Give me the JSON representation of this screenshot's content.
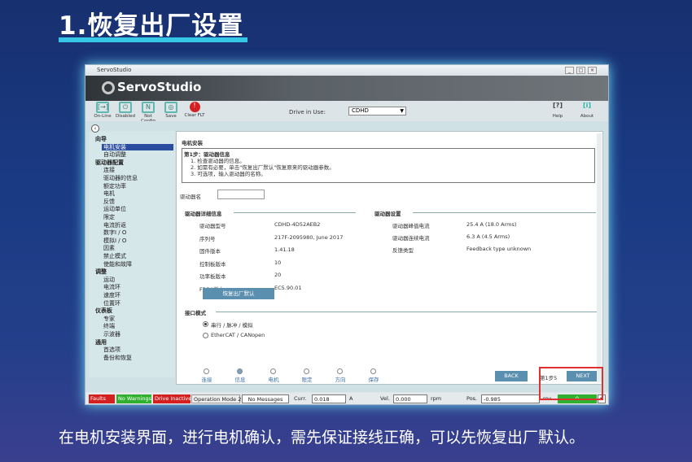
{
  "headline": "1.恢复出厂设置",
  "caption": "在电机安装界面，进行电机确认，需先保证接线正确，可以先恢复出厂默认。",
  "window": {
    "title": "ServoStudio",
    "controls": [
      "_",
      "□",
      "×"
    ]
  },
  "banner": {
    "logo": "ServoStudio"
  },
  "toolbar": {
    "buttons": [
      {
        "label": "On-Line",
        "icon": "online-icon",
        "glyph": "[→]"
      },
      {
        "label": "Disabled",
        "icon": "power-icon",
        "glyph": "⏻"
      },
      {
        "label": "Not Config",
        "icon": "config-icon",
        "glyph": "N"
      },
      {
        "label": "Save",
        "icon": "save-icon",
        "glyph": "◎"
      },
      {
        "label": "Clear FLT",
        "icon": "clear-fault-icon",
        "glyph": "!"
      }
    ],
    "drive_label": "Drive in Use:",
    "drive_value": "CDHD",
    "help": {
      "label": "Help",
      "glyph": "[?]"
    },
    "about": {
      "label": "About",
      "glyph": "[i]"
    }
  },
  "nav": [
    {
      "label": "向导",
      "level": 0,
      "group": true
    },
    {
      "label": "电机安装",
      "level": 1,
      "selected": true
    },
    {
      "label": "自动调整",
      "level": 1
    },
    {
      "label": "驱动器配置",
      "level": 0,
      "group": true
    },
    {
      "label": "连接",
      "level": 1
    },
    {
      "label": "驱动器的信息",
      "level": 1
    },
    {
      "label": "额定功率",
      "level": 1
    },
    {
      "label": "电机",
      "level": 1
    },
    {
      "label": "反馈",
      "level": 1
    },
    {
      "label": "运动单位",
      "level": 1
    },
    {
      "label": "限定",
      "level": 1
    },
    {
      "label": "电流折返",
      "level": 1
    },
    {
      "label": "数字I / O",
      "level": 1
    },
    {
      "label": "模拟I / O",
      "level": 1
    },
    {
      "label": "因素",
      "level": 1
    },
    {
      "label": "禁止模式",
      "level": 1
    },
    {
      "label": "使能和故障",
      "level": 1
    },
    {
      "label": "调整",
      "level": 0,
      "group": true
    },
    {
      "label": "运动",
      "level": 1
    },
    {
      "label": "电流环",
      "level": 1
    },
    {
      "label": "速度环",
      "level": 1
    },
    {
      "label": "位置环",
      "level": 1
    },
    {
      "label": "仪表板",
      "level": 0,
      "group": true
    },
    {
      "label": "专家",
      "level": 1
    },
    {
      "label": "终端",
      "level": 1
    },
    {
      "label": "示波器",
      "level": 1
    },
    {
      "label": "通用",
      "level": 0,
      "group": true
    },
    {
      "label": "首选项",
      "level": 1
    },
    {
      "label": "备份和恢复",
      "level": 1
    }
  ],
  "panel": {
    "title": "电机安装",
    "step_title": "第1步：驱动器信息",
    "step_lines": [
      "1. 检查驱动器的信息。",
      "2. 如需有必要，单击\"恢复出厂默认\"恢复原来的驱动器参数。",
      "3. 可选项，输入驱动器的名称。"
    ],
    "drive_name_label": "驱动器名",
    "drive_name_value": "",
    "details_title": "驱动器详细信息",
    "details": [
      {
        "label": "驱动器型号",
        "value": "CDHD-4D52AEB2"
      },
      {
        "label": "序列号",
        "value": "217F-2095980, June 2017"
      },
      {
        "label": "固件版本",
        "value": "1.41.18"
      },
      {
        "label": "控制板版本",
        "value": "10"
      },
      {
        "label": "功率板版本",
        "value": "20"
      },
      {
        "label": "FPGA版本",
        "value": "EC5.90.01"
      }
    ],
    "restore_button": "恢复出厂默认",
    "settings_title": "驱动器设置",
    "settings": [
      {
        "label": "驱动器峰值电流",
        "value": "25.4  A (18.0 Arms)"
      },
      {
        "label": "驱动器连续电流",
        "value": "6.3  A (4.5 Arms)"
      },
      {
        "label": "反馈类型",
        "value": "Feedback type unknown"
      }
    ],
    "interface_title": "接口模式",
    "interface_options": [
      {
        "label": "串行 / 脉冲 / 模拟",
        "checked": true
      },
      {
        "label": "EtherCAT / CANopen",
        "checked": false
      }
    ],
    "steps": [
      {
        "label": "连接",
        "active": false
      },
      {
        "label": "信息",
        "active": true
      },
      {
        "label": "电机",
        "active": false
      },
      {
        "label": "限定",
        "active": false
      },
      {
        "label": "方向",
        "active": false
      },
      {
        "label": "保存",
        "active": false
      }
    ],
    "back_button": "BACK",
    "step_counter": "第1步5",
    "next_button": "NEXT"
  },
  "status": {
    "faults": "Faults",
    "warnings": "No Warnings",
    "drive_state": "Drive Inactive",
    "op_mode": "Operation Mode 2",
    "messages": "No Messages",
    "curr_label": "Curr.",
    "curr_value": "0.018",
    "curr_unit": "A",
    "vel_label": "Vel.",
    "vel_value": "0.000",
    "vel_unit": "rpm",
    "pos_label": "Pos.",
    "pos_value": "-0.985",
    "pos_unit": "rev",
    "indicator": "0"
  },
  "colors": {
    "accent": "#37c7e6",
    "nav_selected": "#2a4da0",
    "button": "#5b8fb0",
    "fault_red": "#d42020",
    "ok_green": "#2fb12f",
    "highlight": "#e03030"
  }
}
